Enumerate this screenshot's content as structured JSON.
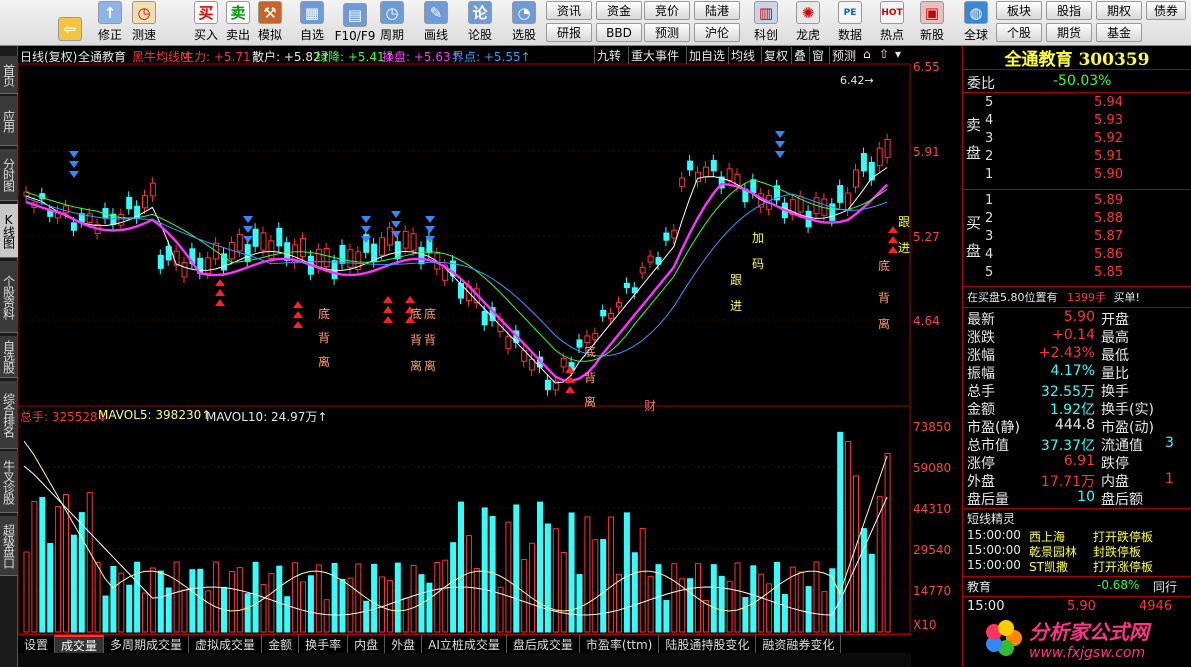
{
  "toolbar": {
    "buttons": [
      {
        "label": "",
        "icon": "windows-logo-icon"
      },
      {
        "label": "",
        "icon": "back-arrow-icon"
      },
      {
        "label": "修正",
        "icon": "fix-icon"
      },
      {
        "label": "测速",
        "icon": "clock-icon"
      },
      {
        "label": "买入",
        "icon": "buy-icon",
        "glyph": "买"
      },
      {
        "label": "卖出",
        "icon": "sell-icon",
        "glyph": "卖"
      },
      {
        "label": "模拟",
        "icon": "gavel-icon"
      },
      {
        "label": "自选",
        "icon": "list-icon"
      },
      {
        "label": "F10/F9",
        "icon": "f10-icon"
      },
      {
        "label": "周期",
        "icon": "cycle-icon"
      },
      {
        "label": "画线",
        "icon": "pencil-icon"
      },
      {
        "label": "论股",
        "icon": "discuss-icon"
      },
      {
        "label": "选股",
        "icon": "magnifier-icon"
      },
      {
        "label": "科创",
        "icon": "kechuang-icon"
      },
      {
        "label": "龙虎",
        "icon": "dragon-icon"
      },
      {
        "label": "数据",
        "icon": "pe-icon",
        "glyph": "PE"
      },
      {
        "label": "热点",
        "icon": "hot-icon",
        "glyph": "HOT"
      },
      {
        "label": "新股",
        "icon": "new-stock-icon"
      },
      {
        "label": "全球",
        "icon": "globe-icon"
      }
    ],
    "small_buttons": [
      [
        "资讯",
        "资金",
        "竞价",
        "陆港"
      ],
      [
        "研报",
        "BBD",
        "预测",
        "沪伦"
      ],
      [
        "板块",
        "股指",
        "期权",
        "债券"
      ],
      [
        "个股",
        "期货",
        "基金"
      ]
    ]
  },
  "left_tabs": [
    "首页",
    "应用",
    "分时图",
    "K线图",
    "个股资料",
    "自选股",
    "综合排名",
    "牛叉诊股",
    "超级盘口"
  ],
  "chart": {
    "header": [
      {
        "text": "日线(复权)",
        "color": "#e6e6e6"
      },
      {
        "text": "全通教育",
        "color": "#e6e6e6"
      },
      {
        "text": "黑牛均线M",
        "color": "#ff3333"
      },
      {
        "text": "主力: +5.71↑",
        "color": "#ff3333"
      },
      {
        "text": "散户: +5.82↑",
        "color": "#e6e6e6"
      },
      {
        "text": "绿降: +5.41↑",
        "color": "#33ff33"
      },
      {
        "text": "操盘: +5.63↑",
        "color": "#ff33ff"
      },
      {
        "text": "界点: +5.55↑",
        "color": "#3399ff"
      }
    ],
    "right_buttons": [
      "九转",
      "重大事件",
      "加自选",
      "均线",
      "复权",
      "叠",
      "窗",
      "预测"
    ],
    "price_axis": [
      "6.55",
      "5.91",
      "5.27",
      "4.64"
    ],
    "high_marker": "6.42",
    "annotations": [
      "底",
      "背",
      "离",
      "底",
      "底",
      "背",
      "背",
      "离",
      "离",
      "底",
      "背",
      "离",
      "财",
      "跟",
      "进",
      "加",
      "码",
      "底",
      "背",
      "离",
      "跟",
      "进"
    ],
    "volume_header": [
      {
        "text": "总手: 325528↓",
        "color": "#ff3333"
      },
      {
        "text": "MAVOL5: 398230↑",
        "color": "#ffff66"
      },
      {
        "text": "MAVOL10: 24.97万↑",
        "color": "#e6e6e6"
      }
    ],
    "volume_axis": [
      "73850",
      "59080",
      "44310",
      "29540",
      "14770",
      "X10"
    ]
  },
  "bottom_tabs": [
    "设置",
    "成交量",
    "多周期成交量",
    "虚拟成交量",
    "金额",
    "换手率",
    "内盘",
    "外盘",
    "AI立桩成交量",
    "盘后成交量",
    "市盈率(ttm)",
    "陆股通持股变化",
    "融资融券变化"
  ],
  "quote": {
    "title": "全通教育 300359",
    "weibi_label": "委比",
    "weibi_value": "-50.03%",
    "sell_label": [
      "卖",
      "盘"
    ],
    "buy_label": [
      "买",
      "盘"
    ],
    "sell": [
      {
        "level": "5",
        "price": "5.94"
      },
      {
        "level": "4",
        "price": "5.93"
      },
      {
        "level": "3",
        "price": "5.92"
      },
      {
        "level": "2",
        "price": "5.91"
      },
      {
        "level": "1",
        "price": "5.90"
      }
    ],
    "buy": [
      {
        "level": "1",
        "price": "5.89"
      },
      {
        "level": "2",
        "price": "5.88"
      },
      {
        "level": "3",
        "price": "5.87"
      },
      {
        "level": "4",
        "price": "5.86"
      },
      {
        "level": "5",
        "price": "5.85"
      }
    ],
    "position_note": "在买盘5.80位置有",
    "position_qty": "1399手",
    "position_action": "买单!",
    "stats": [
      {
        "k": "最新",
        "v": "5.90",
        "vc": "red",
        "k2": "开盘"
      },
      {
        "k": "涨跌",
        "v": "+0.14",
        "vc": "red",
        "k2": "最高"
      },
      {
        "k": "涨幅",
        "v": "+2.43%",
        "vc": "red",
        "k2": "最低"
      },
      {
        "k": "振幅",
        "v": "4.17%",
        "vc": "cyan",
        "k2": "量比"
      },
      {
        "k": "总手",
        "v": "32.55万",
        "vc": "cyan",
        "k2": "换手"
      },
      {
        "k": "金额",
        "v": "1.92亿",
        "vc": "cyan",
        "k2": "换手(实)"
      },
      {
        "k": "市盈(静)",
        "v": "444.8",
        "vc": "white",
        "k2": "市盈(动)"
      },
      {
        "k": "总市值",
        "v": "37.37亿",
        "vc": "cyan",
        "k2": "流通值"
      },
      {
        "k": "涨停",
        "v": "6.91",
        "vc": "red",
        "k2": "跌停"
      },
      {
        "k": "外盘",
        "v": "17.71万",
        "vc": "red",
        "k2": "内盘"
      },
      {
        "k": "盘后量",
        "v": "10",
        "vc": "cyan",
        "k2": "盘后额"
      }
    ],
    "stats_tail": [
      "",
      "",
      "",
      "",
      "",
      "",
      "",
      "3",
      "",
      "1",
      ""
    ],
    "news_title": "短线精灵",
    "news": [
      {
        "t": "15:00:00",
        "n": "西上海",
        "e": "打开跌停板"
      },
      {
        "t": "15:00:00",
        "n": "乾景园林",
        "e": "封跌停板"
      },
      {
        "t": "15:00:00",
        "n": "ST凯撒",
        "e": "打开涨停板"
      }
    ],
    "sector_name": "教育",
    "sector_change": "-0.68%",
    "sector_peer": "同行",
    "last_time": "15:00",
    "last_price": "5.90",
    "last_qty": "4946"
  },
  "watermark": {
    "title": "分析家公式网",
    "url": "www.fxjgsw.com"
  }
}
